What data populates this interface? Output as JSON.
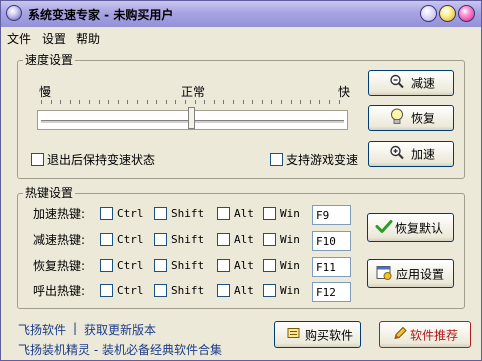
{
  "window": {
    "title": "系统变速专家 - 未购买用户"
  },
  "menu": [
    "文件",
    "设置",
    "帮助"
  ],
  "speed": {
    "group_title": "速度设置",
    "slow_label": "慢",
    "normal_label": "正常",
    "fast_label": "快",
    "slider_fraction": 0.5,
    "keep_on_exit": "退出后保持变速状态",
    "game_support": "支持游戏变速",
    "btn_slow": "减速",
    "btn_restore": "恢复",
    "btn_fast": "加速"
  },
  "hotkeys": {
    "group_title": "热键设置",
    "modifiers": [
      "Ctrl",
      "Shift",
      "Alt",
      "Win"
    ],
    "rows": [
      {
        "label": "加速热键:",
        "key": "F9"
      },
      {
        "label": "减速热键:",
        "key": "F10"
      },
      {
        "label": "恢复热键:",
        "key": "F11"
      },
      {
        "label": "呼出热键:",
        "key": "F12"
      }
    ],
    "btn_default": "恢复默认",
    "btn_apply": "应用设置"
  },
  "footer": {
    "link1": "飞扬软件",
    "sep": "|",
    "link2": "获取更新版本",
    "link3": "飞扬装机精灵 - 装机必备经典软件合集",
    "btn_buy": "购买软件",
    "btn_recommend": "软件推荐"
  }
}
